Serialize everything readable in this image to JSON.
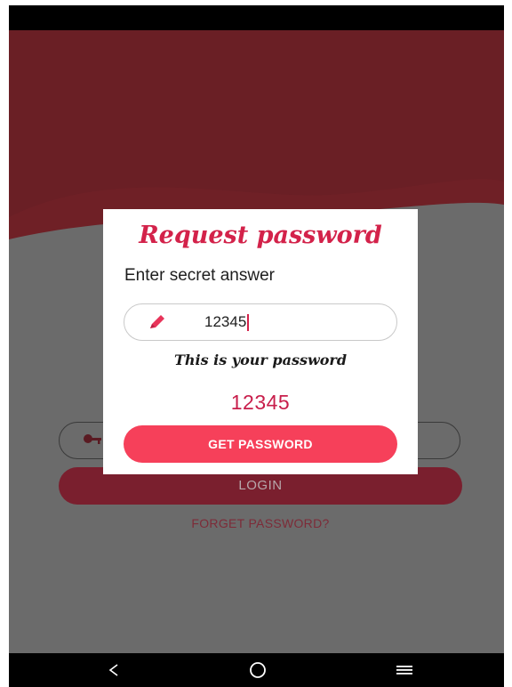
{
  "background": {
    "login_label": "LOGIN",
    "forget_label": "FORGET PASSWORD?",
    "field_icon": "key-icon"
  },
  "dialog": {
    "title": "Request password",
    "prompt": "Enter secret answer",
    "answer_icon": "pencil-icon",
    "answer_value": "12345",
    "note": "This is your password",
    "password": "12345",
    "button_label": "GET PASSWORD"
  },
  "nav": {
    "back_icon": "back-icon",
    "home_icon": "home-icon",
    "menu_icon": "menu-icon"
  },
  "colors": {
    "accent": "#f6405a",
    "title": "#d3224a",
    "header_dark": "#651e24"
  }
}
